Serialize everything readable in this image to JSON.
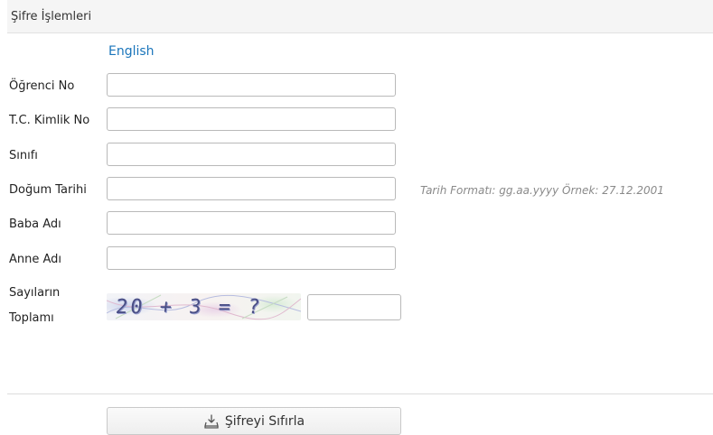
{
  "panel": {
    "title": "Şifre İşlemleri"
  },
  "language_link": "English",
  "form": {
    "student_no_label": "Öğrenci No",
    "tc_no_label": "T.C. Kimlik No",
    "class_label": "Sınıfı",
    "birth_date_label": "Doğum Tarihi",
    "birth_date_hint": "Tarih Formatı: gg.aa.yyyy     Örnek: 27.12.2001",
    "father_name_label": "Baba Adı",
    "mother_name_label": "Anne Adı",
    "captcha_label_line1": "Sayıların",
    "captcha_label_line2": "Toplamı",
    "captcha_text": "20 + 3 = ?"
  },
  "actions": {
    "reset_label": "Şifreyi Sıfırla",
    "reset_icon": "download-tray-icon"
  },
  "colors": {
    "link": "#1a75bb",
    "hint": "#8a8a8a",
    "header_bg": "#f5f5f5"
  }
}
